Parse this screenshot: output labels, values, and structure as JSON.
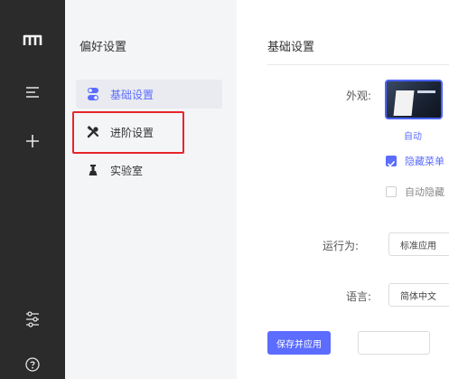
{
  "rail": {
    "icons": [
      "logo-icon",
      "menu-icon",
      "plus-icon",
      "settings-sliders-icon",
      "help-icon"
    ]
  },
  "sidebar": {
    "title": "偏好设置",
    "items": [
      {
        "label": "基础设置",
        "icon": "toggle-icon",
        "active": true
      },
      {
        "label": "进阶设置",
        "icon": "tools-icon",
        "active": false
      },
      {
        "label": "实验室",
        "icon": "flask-icon",
        "active": false
      }
    ],
    "highlight_color": "#e5262a"
  },
  "main": {
    "title": "基础设置",
    "appearance": {
      "label": "外观:",
      "option": "自动"
    },
    "checkbox_hide_menu": {
      "label": "隐藏菜单",
      "checked": true
    },
    "checkbox_auto_hide": {
      "label": "自动隐藏",
      "checked": false
    },
    "run_behavior": {
      "label": "运行为:",
      "value": "标准应用"
    },
    "language": {
      "label": "语言:",
      "value": "简体中文"
    },
    "save_label": "保存并应用"
  },
  "colors": {
    "accent": "#5b6cff",
    "rail_bg": "#2b2b2b",
    "sidebar_bg": "#f4f5f7"
  }
}
